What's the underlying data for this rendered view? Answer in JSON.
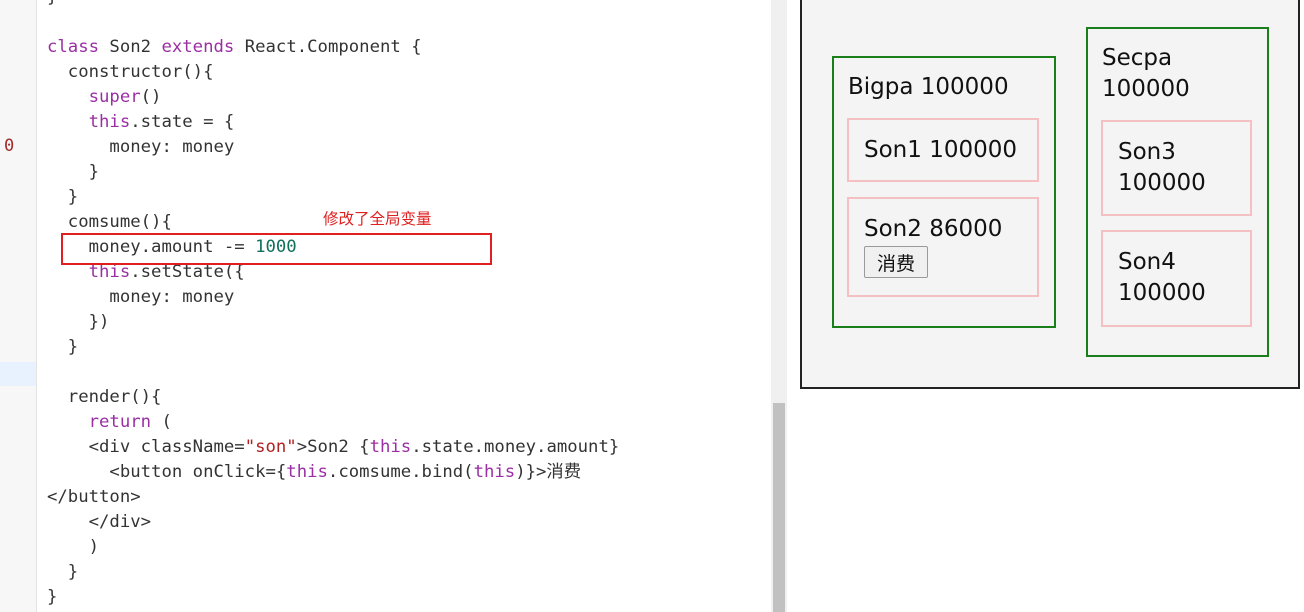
{
  "editor": {
    "gutter_marker": "0",
    "annotation": "修改了全局变量",
    "code_lines": [
      [
        {
          "t": "}"
        }
      ],
      [],
      [
        {
          "t": "class",
          "c": "kw"
        },
        {
          "t": " Son2 "
        },
        {
          "t": "extends",
          "c": "kw"
        },
        {
          "t": " React.Component {"
        }
      ],
      [
        {
          "t": "  constructor(){"
        }
      ],
      [
        {
          "t": "    "
        },
        {
          "t": "super",
          "c": "kw"
        },
        {
          "t": "()"
        }
      ],
      [
        {
          "t": "    "
        },
        {
          "t": "this",
          "c": "kw"
        },
        {
          "t": ".state = {"
        }
      ],
      [
        {
          "t": "      money: money"
        }
      ],
      [
        {
          "t": "    }"
        }
      ],
      [
        {
          "t": "  }"
        }
      ],
      [
        {
          "t": "  comsume(){"
        }
      ],
      [
        {
          "t": "    money.amount -= "
        },
        {
          "t": "1000",
          "c": "num"
        }
      ],
      [
        {
          "t": "    "
        },
        {
          "t": "this",
          "c": "kw"
        },
        {
          "t": ".setState({"
        }
      ],
      [
        {
          "t": "      money: money"
        }
      ],
      [
        {
          "t": "    })"
        }
      ],
      [
        {
          "t": "  }"
        }
      ],
      [],
      [
        {
          "t": "  render(){"
        }
      ],
      [
        {
          "t": "    "
        },
        {
          "t": "return",
          "c": "kw"
        },
        {
          "t": " ("
        }
      ],
      [
        {
          "t": "    <div className="
        },
        {
          "t": "\"son\"",
          "c": "str"
        },
        {
          "t": ">Son2 {"
        },
        {
          "t": "this",
          "c": "kw"
        },
        {
          "t": ".state.money.amount}"
        }
      ],
      [
        {
          "t": "      <button onClick={"
        },
        {
          "t": "this",
          "c": "kw"
        },
        {
          "t": ".comsume.bind("
        },
        {
          "t": "this",
          "c": "kw"
        },
        {
          "t": ")}>消费"
        }
      ],
      [
        {
          "t": "</button>"
        }
      ],
      [
        {
          "t": "    </div>"
        }
      ],
      [
        {
          "t": "    )"
        }
      ],
      [
        {
          "t": "  }"
        }
      ],
      [
        {
          "t": "}"
        }
      ]
    ]
  },
  "preview": {
    "bigpa": {
      "label": "Bigpa 100000"
    },
    "son1": {
      "label": "Son1 100000"
    },
    "son2": {
      "label": "Son2 86000",
      "button_label": "消费"
    },
    "secpa": {
      "label_line1": "Secpa",
      "label_line2": "100000"
    },
    "son3": {
      "label_line1": "Son3",
      "label_line2": "100000"
    },
    "son4": {
      "label_line1": "Son4",
      "label_line2": "100000"
    }
  },
  "colors": {
    "keyword": "#9a2fa3",
    "string": "#b22222",
    "number": "#11705c",
    "annotation": "#e02020",
    "parent_border": "#1a7f1a",
    "child_border": "#f5c0c4"
  }
}
